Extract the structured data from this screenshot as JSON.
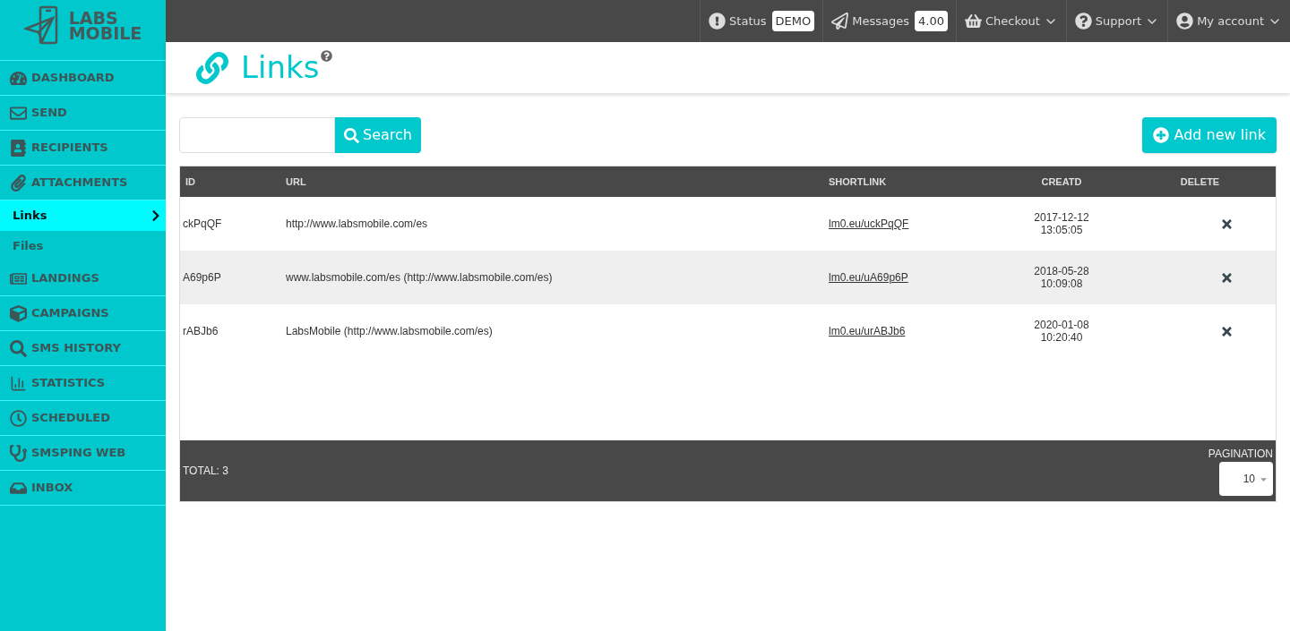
{
  "logo": {
    "lines": [
      "LABS",
      "MOBILE"
    ]
  },
  "sidebar": {
    "items": [
      {
        "label": "DASHBOARD",
        "kind": "main",
        "selected": false
      },
      {
        "label": "SEND",
        "kind": "main",
        "selected": false
      },
      {
        "label": "RECIPIENTS",
        "kind": "main",
        "selected": false
      },
      {
        "label": "ATTACHMENTS",
        "kind": "main",
        "selected": false
      },
      {
        "label": "Links",
        "kind": "sub",
        "selected": true
      },
      {
        "label": "Files",
        "kind": "sub",
        "selected": false
      },
      {
        "label": "LANDINGS",
        "kind": "main",
        "selected": false
      },
      {
        "label": "CAMPAIGNS",
        "kind": "main",
        "selected": false
      },
      {
        "label": "SMS HISTORY",
        "kind": "main",
        "selected": false
      },
      {
        "label": "STATISTICS",
        "kind": "main",
        "selected": false
      },
      {
        "label": "SCHEDULED",
        "kind": "main",
        "selected": false
      },
      {
        "label": "SMSPING WEB",
        "kind": "main",
        "selected": false
      },
      {
        "label": "INBOX",
        "kind": "main",
        "selected": false
      }
    ]
  },
  "topbar": {
    "items": [
      {
        "label": "Status",
        "badge": "DEMO",
        "dropdown": false
      },
      {
        "label": "Messages",
        "badge": "4.00",
        "dropdown": false
      },
      {
        "label": "Checkout",
        "dropdown": true
      },
      {
        "label": "Support",
        "dropdown": true
      },
      {
        "label": "My account",
        "dropdown": true
      }
    ]
  },
  "page": {
    "title": "Links"
  },
  "search": {
    "button": "Search"
  },
  "add_button": "Add new link",
  "table": {
    "columns": [
      "ID",
      "URL",
      "SHORTLINK",
      "CREATD",
      "DELETE"
    ],
    "rows": [
      {
        "id": "ckPqQF",
        "url": "http://www.labsmobile.com/es",
        "shortlink": "lm0.eu/uckPqQF",
        "created": [
          "2017-12-12",
          "13:05:05"
        ]
      },
      {
        "id": "A69p6P",
        "url": "www.labsmobile.com/es (http://www.labsmobile.com/es)",
        "shortlink": "lm0.eu/uA69p6P",
        "created": [
          "2018-05-28",
          "10:09:08"
        ]
      },
      {
        "id": "rABJb6",
        "url": "LabsMobile (http://www.labsmobile.com/es)",
        "shortlink": "lm0.eu/urABJb6",
        "created": [
          "2020-01-08",
          "10:20:40"
        ]
      }
    ],
    "total": "TOTAL: 3",
    "pagination": {
      "label": "PAGINATION",
      "value": "10"
    }
  }
}
